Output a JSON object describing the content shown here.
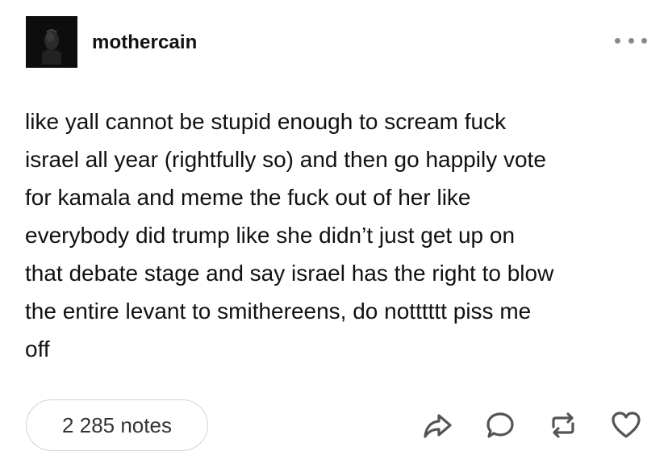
{
  "post": {
    "username": "mothercain",
    "body": "like yall cannot be stupid enough to scream fuck\nisrael all year (rightfully so) and then go happily vote\nfor kamala and meme the fuck out of her like\neverybody did trump like she didn’t just get up on\nthat debate stage and say israel has the right to blow\nthe entire levant to smithereens, do notttttt piss me\noff",
    "notes_label": "2 285 notes"
  },
  "icons": {
    "more": "more-icon",
    "share": "share-icon",
    "reply": "reply-icon",
    "reblog": "reblog-icon",
    "like": "heart-icon"
  },
  "colors": {
    "text": "#111111",
    "icon": "#555555",
    "muted": "#8a8a8a",
    "border": "#d4d4d4"
  }
}
